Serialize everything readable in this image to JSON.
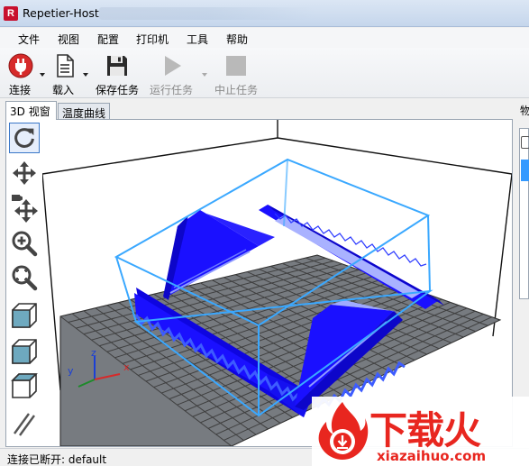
{
  "window": {
    "title": "Repetier-Host",
    "app_icon_letter": "R"
  },
  "menu": {
    "items": [
      "文件",
      "视图",
      "配置",
      "打印机",
      "工具",
      "帮助"
    ]
  },
  "toolbar": {
    "buttons": [
      {
        "label": "连接",
        "icon": "power-plug-icon",
        "enabled": true,
        "dropdown": true
      },
      {
        "label": "载入",
        "icon": "document-icon",
        "enabled": true,
        "dropdown": true
      },
      {
        "label": "保存任务",
        "icon": "floppy-disk-icon",
        "enabled": true,
        "dropdown": false
      },
      {
        "label": "运行任务",
        "icon": "play-icon",
        "enabled": false,
        "dropdown": true
      },
      {
        "label": "中止任务",
        "icon": "stop-icon",
        "enabled": false,
        "dropdown": false
      }
    ]
  },
  "tabs": [
    {
      "label": "3D 视窗",
      "active": true
    },
    {
      "label": "温度曲线",
      "active": false
    }
  ],
  "side_tools": [
    "rotate-icon",
    "move-icon",
    "move-object-icon",
    "zoom-icon",
    "fit-view-icon",
    "iso-view-icon",
    "front-view-icon",
    "top-view-icon",
    "parallel-lines-icon"
  ],
  "axis_labels": {
    "x": "x",
    "y": "y",
    "z": "z"
  },
  "right_panel": {
    "tab_label": "物"
  },
  "status": {
    "text": "连接已断开: default"
  },
  "watermark": {
    "cn": "下载火",
    "en": "xiazaihuo.com"
  },
  "colors": {
    "model": "#1a10ff",
    "model_highlight": "#9aa6ff",
    "bounding_box": "#3aa8ff",
    "grid": "#4a4a4a",
    "bed_fill": "#777b80",
    "connect_red": "#d62a2a",
    "watermark": "#e8261f"
  }
}
